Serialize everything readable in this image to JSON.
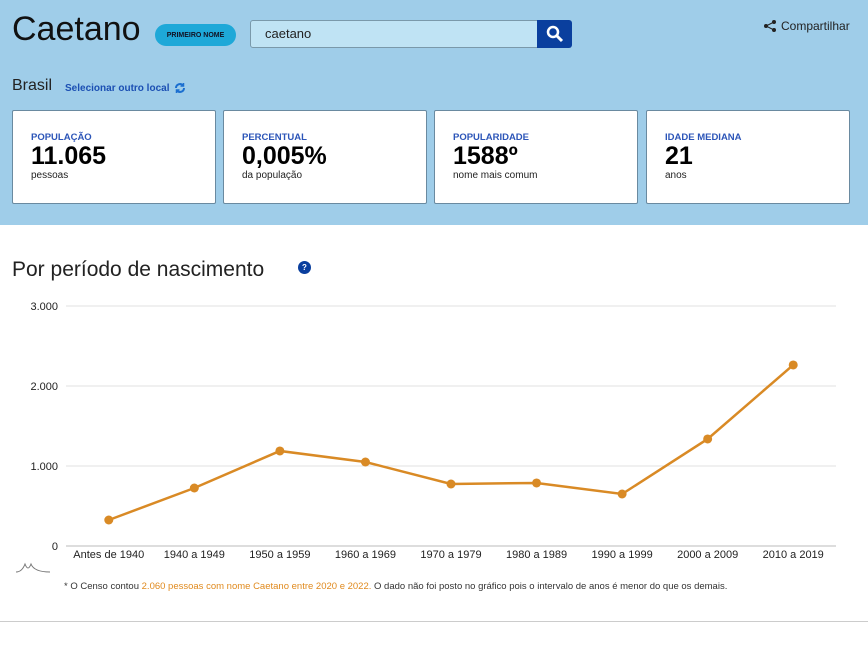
{
  "header": {
    "title": "Caetano",
    "badge": "PRIMEIRO NOME",
    "search_value": "caetano",
    "share_label": "Compartilhar",
    "location": "Brasil",
    "select_location": "Selecionar outro local"
  },
  "cards": [
    {
      "label": "POPULAÇÃO",
      "value": "11.065",
      "sub": "pessoas"
    },
    {
      "label": "PERCENTUAL",
      "value": "0,005%",
      "sub": "da população"
    },
    {
      "label": "POPULARIDADE",
      "value": "1588º",
      "sub": "nome mais comum"
    },
    {
      "label": "IDADE MEDIANA",
      "value": "21",
      "sub": "anos"
    }
  ],
  "section": {
    "title": "Por período de nascimento",
    "help": "?"
  },
  "note": {
    "prefix": "* O Censo contou ",
    "highlight": "2.060 pessoas com nome Caetano entre 2020 e 2022.",
    "suffix": " O dado não foi posto no gráfico pois o intervalo de anos é menor do que os demais."
  },
  "colors": {
    "line": "#d98a25",
    "header_bg": "#9fcde9",
    "accent": "#0a3f9e"
  },
  "chart_data": {
    "type": "line",
    "categories": [
      "Antes de 1940",
      "1940 a 1949",
      "1950 a 1959",
      "1960 a 1969",
      "1970 a 1979",
      "1980 a 1989",
      "1990 a 1999",
      "2000 a 2009",
      "2010 a 2019"
    ],
    "values": [
      325,
      725,
      1188,
      1050,
      775,
      788,
      650,
      1338,
      2263
    ],
    "ylim": [
      0,
      3000
    ],
    "yticks": [
      0,
      1000,
      2000,
      3000
    ],
    "ytick_labels": [
      "0",
      "1.000",
      "2.000",
      "3.000"
    ],
    "grid": true
  }
}
